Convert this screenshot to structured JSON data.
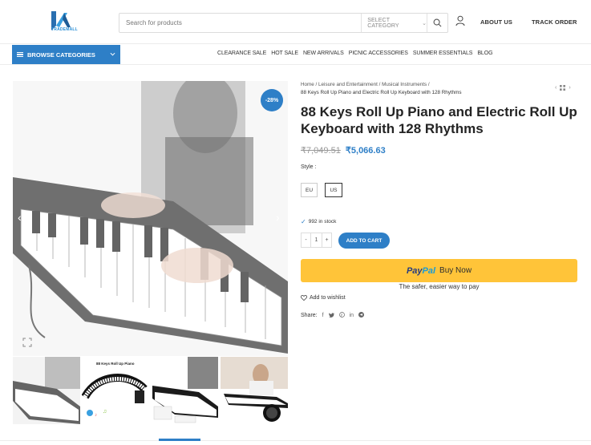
{
  "header": {
    "logo_text": "TRADEMALL",
    "search_placeholder": "Search for products",
    "category_label": "SELECT CATEGORY",
    "about_label": "ABOUT US",
    "track_label": "TRACK ORDER"
  },
  "nav": {
    "browse_label": "BROWSE CATEGORIES",
    "items": [
      "CLEARANCE SALE",
      "HOT SALE",
      "NEW ARRIVALS",
      "PICNIC ACCESSORIES",
      "SUMMER ESSENTIALS",
      "BLOG"
    ]
  },
  "gallery": {
    "discount_badge": "-28%",
    "thumb2_title": "88 Keys Roll Up Piano"
  },
  "product": {
    "breadcrumb": [
      "Home",
      "Leisure and Entertainment",
      "Musical Instruments"
    ],
    "breadcrumb_current": "88 Keys Roll Up Piano and Electric Roll Up Keyboard with 128 Rhythms",
    "title": "88 Keys Roll Up Piano and Electric Roll Up Keyboard with 128 Rhythms",
    "old_price": "₹7,049.51",
    "new_price": "₹5,066.63",
    "style_label": "Style :",
    "styles": [
      "EU",
      "US"
    ],
    "selected_style": "US",
    "stock_text": "992 in stock",
    "qty": "1",
    "qty_minus": "-",
    "qty_plus": "+",
    "add_to_cart": "ADD TO CART",
    "paypal_1": "Pay",
    "paypal_2": "Pal",
    "buy_now": "Buy Now",
    "paypal_tagline": "The safer, easier way to pay",
    "wishlist": "Add to wishlist",
    "share_label": "Share:",
    "share_icons": [
      "facebook-icon",
      "twitter-icon",
      "pinterest-icon",
      "linkedin-icon",
      "telegram-icon"
    ]
  },
  "colors": {
    "accent": "#2e7fc7",
    "paypal": "#ffc439"
  }
}
